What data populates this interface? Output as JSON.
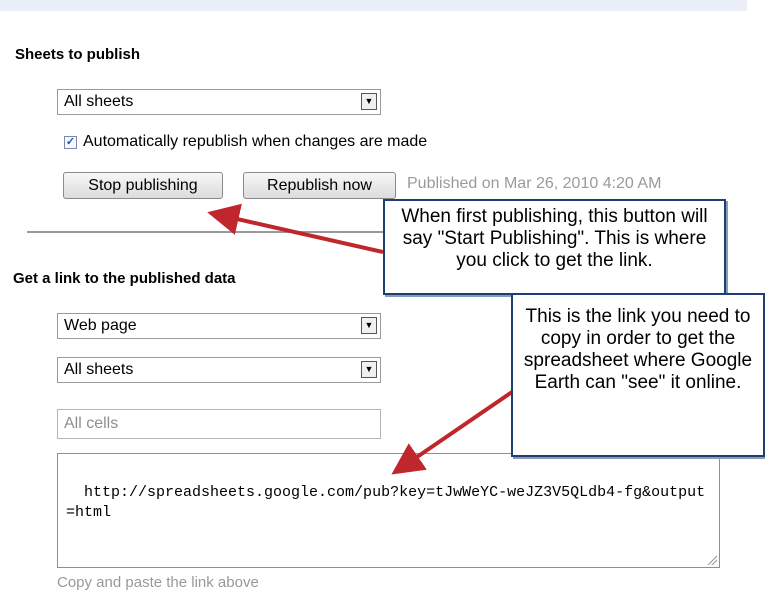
{
  "sheets_to_publish": {
    "title": "Sheets to publish",
    "select_value": "All sheets",
    "auto_republish_label": "Automatically republish when changes are made",
    "auto_republish_checked": true,
    "stop_button_label": "Stop publishing",
    "republish_button_label": "Republish now",
    "status_text": "Published on Mar 26, 2010 4:20 AM"
  },
  "link_section": {
    "title": "Get a link to the published data",
    "format_select_value": "Web page",
    "sheets_select_value": "All sheets",
    "cells_input_value": "All cells",
    "link_text": "http://spreadsheets.google.com/pub?key=tJwWeYC-weJZ3V5QLdb4-fg&output=html",
    "hint": "Copy and paste the link above"
  },
  "callouts": {
    "button_note": "When first publishing, this button will say \"Start Publishing\".  This is where you click to get the link.",
    "link_note": "This is the link you need to copy in order to get the spreadsheet where Google Earth can \"see\" it online."
  },
  "colors": {
    "arrow": "#c0272d",
    "callout_border": "#1f3f73"
  },
  "icons": {
    "dropdown": "dropdown-arrow-icon",
    "checkbox": "checkmark-icon",
    "resize": "resize-grip-icon"
  }
}
